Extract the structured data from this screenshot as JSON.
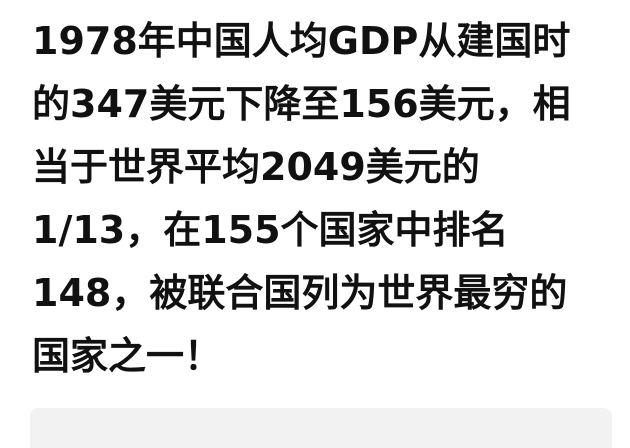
{
  "post": {
    "lines": [
      "1978年中国人均GDP从建国时",
      "的347美元下降至156美元，相",
      "当于世界平均2049美元的",
      "1/13，在155个国家中排名",
      "148，被联合国列为世界最穷的",
      "国家之一！"
    ]
  },
  "colors": {
    "text": "#111111",
    "background": "#ffffff",
    "card": "#f2f2f2"
  }
}
